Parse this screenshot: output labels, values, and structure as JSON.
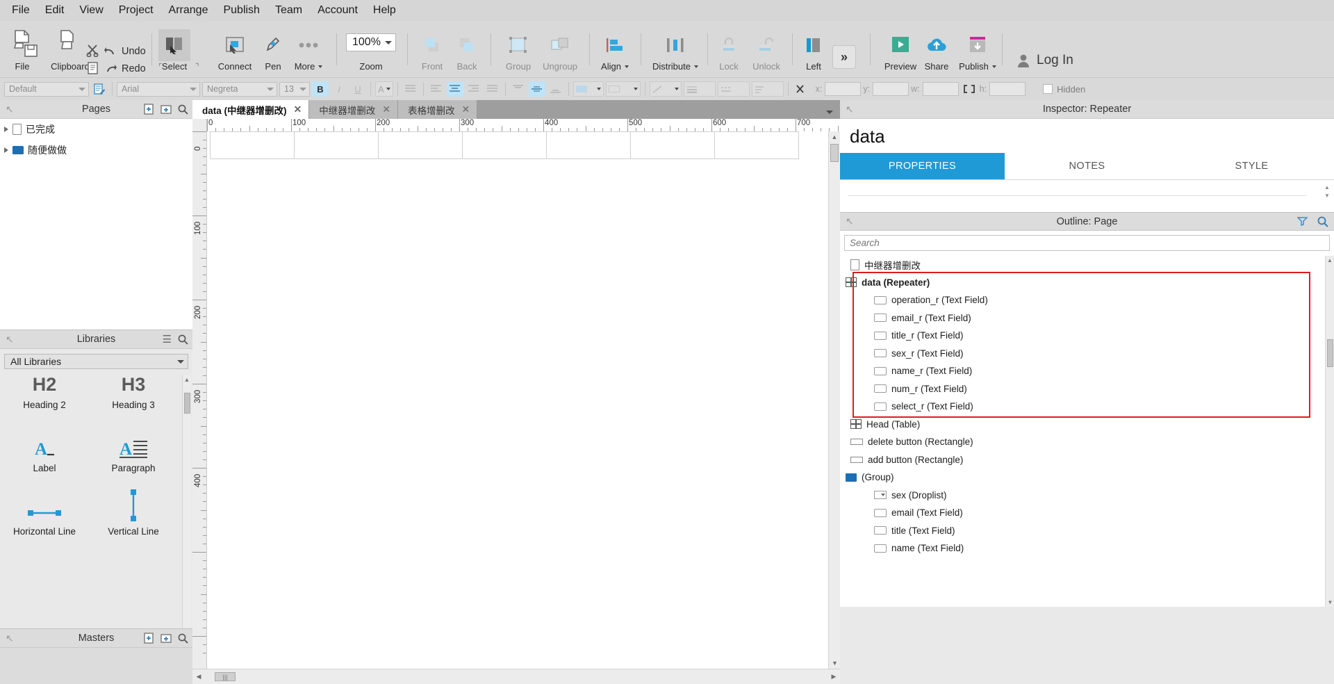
{
  "menu": {
    "items": [
      "File",
      "Edit",
      "View",
      "Project",
      "Arrange",
      "Publish",
      "Team",
      "Account",
      "Help"
    ]
  },
  "ribbon": {
    "file_label": "File",
    "clipboard_label": "Clipboard",
    "undo_label": "Undo",
    "redo_label": "Redo",
    "select_label": "Select",
    "connect_label": "Connect",
    "pen_label": "Pen",
    "more_label": "More",
    "zoom_value": "100%",
    "zoom_label": "Zoom",
    "front_label": "Front",
    "back_label": "Back",
    "group_label": "Group",
    "ungroup_label": "Ungroup",
    "align_label": "Align",
    "distribute_label": "Distribute",
    "lock_label": "Lock",
    "unlock_label": "Unlock",
    "left_label": "Left",
    "overflow_label": "»",
    "preview_label": "Preview",
    "share_label": "Share",
    "publish_label": "Publish",
    "login_label": "Log In"
  },
  "stylebar": {
    "style_value": "Default",
    "font_value": "Arial",
    "weight_value": "Negreta",
    "size_value": "13",
    "bold": "B",
    "italic": "I",
    "underline": "U",
    "font_color": "A",
    "x_label": "x:",
    "y_label": "y:",
    "w_label": "w:",
    "h_label": "h:",
    "x_value": "",
    "y_value": "",
    "w_value": "",
    "h_value": "",
    "hidden_label": "Hidden"
  },
  "pages": {
    "title": "Pages",
    "items": [
      {
        "label": "已完成",
        "type": "page"
      },
      {
        "label": "随便做做",
        "type": "folder"
      }
    ]
  },
  "libraries": {
    "title": "Libraries",
    "selected": "All Libraries",
    "items": [
      {
        "label": "Heading 2",
        "glyph": "H2"
      },
      {
        "label": "Heading 3",
        "glyph": "H3"
      },
      {
        "label": "Label",
        "glyph": "A_"
      },
      {
        "label": "Paragraph",
        "glyph": "A≡"
      },
      {
        "label": "Horizontal Line",
        "glyph": "hline"
      },
      {
        "label": "Vertical Line",
        "glyph": "vline"
      }
    ]
  },
  "masters": {
    "title": "Masters"
  },
  "canvas": {
    "tabs": [
      {
        "label": "data (中继器增删改)",
        "active": true
      },
      {
        "label": "中继器增删改",
        "active": false
      },
      {
        "label": "表格增删改",
        "active": false
      }
    ],
    "h_ruler_labels": [
      "0",
      "100",
      "200",
      "300",
      "400",
      "500",
      "600",
      "700"
    ],
    "v_ruler_labels": [
      "0",
      "100",
      "200",
      "300",
      "400"
    ]
  },
  "inspector": {
    "header": "Inspector: Repeater",
    "title": "data",
    "tabs": [
      {
        "label": "PROPERTIES",
        "active": true
      },
      {
        "label": "NOTES",
        "active": false
      },
      {
        "label": "STYLE",
        "active": false
      }
    ]
  },
  "outline": {
    "header": "Outline: Page",
    "search_placeholder": "Search",
    "items": [
      {
        "label": "中继器增删改",
        "icon": "page",
        "indent": 0,
        "expander": false,
        "bold": false,
        "highlight": false
      },
      {
        "label": "data (Repeater)",
        "icon": "table",
        "indent": 0,
        "expander": true,
        "bold": true,
        "highlight": true
      },
      {
        "label": "operation_r (Text Field)",
        "icon": "field",
        "indent": 1,
        "expander": false,
        "bold": false,
        "highlight": true
      },
      {
        "label": "email_r (Text Field)",
        "icon": "field",
        "indent": 1,
        "expander": false,
        "bold": false,
        "highlight": true
      },
      {
        "label": "title_r (Text Field)",
        "icon": "field",
        "indent": 1,
        "expander": false,
        "bold": false,
        "highlight": true
      },
      {
        "label": "sex_r (Text Field)",
        "icon": "field",
        "indent": 1,
        "expander": false,
        "bold": false,
        "highlight": true
      },
      {
        "label": "name_r (Text Field)",
        "icon": "field",
        "indent": 1,
        "expander": false,
        "bold": false,
        "highlight": true
      },
      {
        "label": "num_r (Text Field)",
        "icon": "field",
        "indent": 1,
        "expander": false,
        "bold": false,
        "highlight": true
      },
      {
        "label": "select_r (Text Field)",
        "icon": "field",
        "indent": 1,
        "expander": false,
        "bold": false,
        "highlight": true
      },
      {
        "label": "Head (Table)",
        "icon": "table",
        "indent": 0,
        "expander": false,
        "bold": false,
        "highlight": false
      },
      {
        "label": "delete button (Rectangle)",
        "icon": "rect",
        "indent": 0,
        "expander": false,
        "bold": false,
        "highlight": false
      },
      {
        "label": "add button (Rectangle)",
        "icon": "rect",
        "indent": 0,
        "expander": false,
        "bold": false,
        "highlight": false
      },
      {
        "label": "(Group)",
        "icon": "folder",
        "indent": 0,
        "expander": true,
        "bold": false,
        "highlight": false
      },
      {
        "label": "sex (Droplist)",
        "icon": "drop",
        "indent": 1,
        "expander": false,
        "bold": false,
        "highlight": false
      },
      {
        "label": "email (Text Field)",
        "icon": "field",
        "indent": 1,
        "expander": false,
        "bold": false,
        "highlight": false
      },
      {
        "label": "title (Text Field)",
        "icon": "field",
        "indent": 1,
        "expander": false,
        "bold": false,
        "highlight": false
      },
      {
        "label": "name (Text Field)",
        "icon": "field",
        "indent": 1,
        "expander": false,
        "bold": false,
        "highlight": false
      }
    ]
  },
  "colors": {
    "accent": "#1f9ad6",
    "highlight_border": "#e01b1b",
    "tab_active_bg": "#1f9ad6"
  }
}
